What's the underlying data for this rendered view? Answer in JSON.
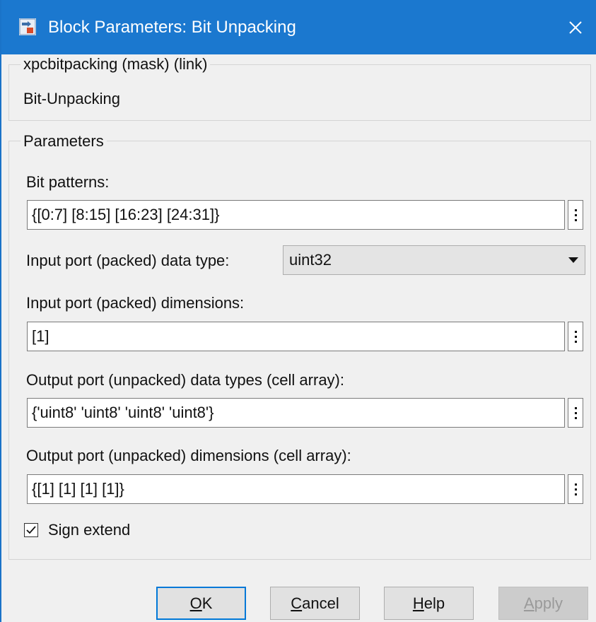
{
  "window": {
    "title": "Block Parameters: Bit Unpacking",
    "icon": "simulink-block-icon",
    "close": "close-icon"
  },
  "mask": {
    "legend": "xpcbitpacking (mask) (link)",
    "description": "Bit-Unpacking"
  },
  "parameters": {
    "legend": "Parameters",
    "bit_patterns_label": "Bit patterns:",
    "bit_patterns_value": "{[0:7] [8:15] [16:23] [24:31]}",
    "input_type_label": "Input port (packed) data type:",
    "input_type_value": "uint32",
    "input_dims_label": "Input port (packed) dimensions:",
    "input_dims_value": "[1]",
    "output_types_label": "Output port (unpacked) data types (cell array):",
    "output_types_value": "{'uint8' 'uint8' 'uint8' 'uint8'}",
    "output_dims_label": "Output port (unpacked) dimensions (cell array):",
    "output_dims_value": "{[1] [1] [1] [1]}",
    "sign_extend_label": "Sign extend",
    "sign_extend_checked": true
  },
  "buttons": {
    "ok": "OK",
    "cancel": "Cancel",
    "help": "Help",
    "apply": "Apply"
  },
  "colors": {
    "titlebar": "#1b78cf",
    "default_button_border": "#0078d7"
  }
}
